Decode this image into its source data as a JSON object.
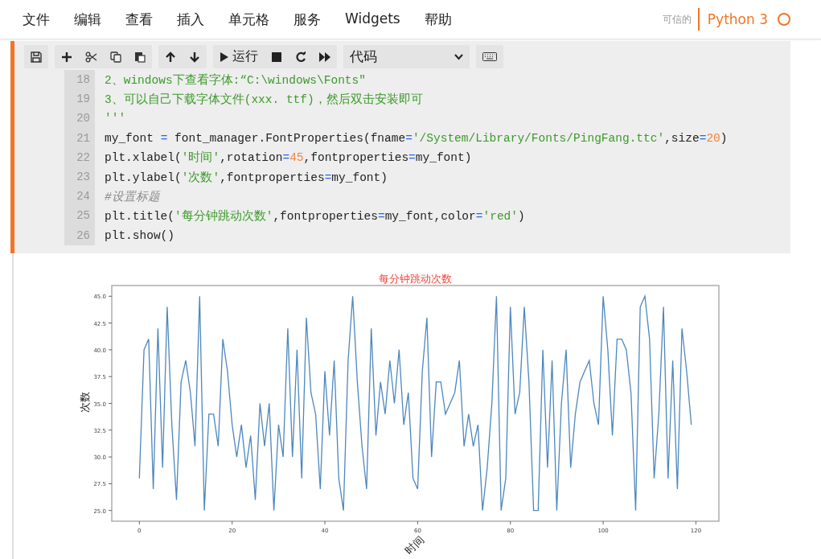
{
  "menu": [
    {
      "label": "文件"
    },
    {
      "label": "编辑"
    },
    {
      "label": "查看"
    },
    {
      "label": "插入"
    },
    {
      "label": "单元格"
    },
    {
      "label": "服务"
    },
    {
      "label": "Widgets"
    },
    {
      "label": "帮助"
    }
  ],
  "kernel": {
    "trusted_label": "可信的",
    "name": "Python 3",
    "busy": false
  },
  "toolbar": {
    "run_label": "运行",
    "cell_type": "代码"
  },
  "code_lines": [
    {
      "number": "18",
      "tokens": [
        {
          "kind": "str",
          "text": "2、windows下查看字体:“C:\\windows\\Fonts\""
        }
      ]
    },
    {
      "number": "19",
      "tokens": [
        {
          "kind": "str",
          "text": "3、可以自己下载字体文件(xxx. ttf)，然后双击安装即可"
        }
      ]
    },
    {
      "number": "20",
      "tokens": [
        {
          "kind": "str",
          "text": "'''"
        }
      ]
    },
    {
      "number": "21",
      "tokens": [
        {
          "kind": "plain",
          "text": "my_font "
        },
        {
          "kind": "op",
          "text": "="
        },
        {
          "kind": "plain",
          "text": " font_manager.FontProperties(fname"
        },
        {
          "kind": "op",
          "text": "="
        },
        {
          "kind": "str",
          "text": "'/System/Library/Fonts/PingFang.ttc'"
        },
        {
          "kind": "plain",
          "text": ",size"
        },
        {
          "kind": "op",
          "text": "="
        },
        {
          "kind": "num",
          "text": "20"
        },
        {
          "kind": "plain",
          "text": ")"
        }
      ]
    },
    {
      "number": "22",
      "tokens": [
        {
          "kind": "plain",
          "text": "plt.xlabel("
        },
        {
          "kind": "str",
          "text": "'时间'"
        },
        {
          "kind": "plain",
          "text": ",rotation"
        },
        {
          "kind": "op",
          "text": "="
        },
        {
          "kind": "num",
          "text": "45"
        },
        {
          "kind": "plain",
          "text": ",fontproperties"
        },
        {
          "kind": "op",
          "text": "="
        },
        {
          "kind": "plain",
          "text": "my_font)"
        }
      ]
    },
    {
      "number": "23",
      "tokens": [
        {
          "kind": "plain",
          "text": "plt.ylabel("
        },
        {
          "kind": "str",
          "text": "'次数'"
        },
        {
          "kind": "plain",
          "text": ",fontproperties"
        },
        {
          "kind": "op",
          "text": "="
        },
        {
          "kind": "plain",
          "text": "my_font)"
        }
      ]
    },
    {
      "number": "24",
      "tokens": [
        {
          "kind": "comment",
          "text": "#设置标题"
        }
      ]
    },
    {
      "number": "25",
      "tokens": [
        {
          "kind": "plain",
          "text": "plt.title("
        },
        {
          "kind": "str",
          "text": "'每分钟跳动次数'"
        },
        {
          "kind": "plain",
          "text": ",fontproperties"
        },
        {
          "kind": "op",
          "text": "="
        },
        {
          "kind": "plain",
          "text": "my_font,color"
        },
        {
          "kind": "op",
          "text": "="
        },
        {
          "kind": "str",
          "text": "'red'"
        },
        {
          "kind": "plain",
          "text": ")"
        }
      ]
    },
    {
      "number": "26",
      "tokens": [
        {
          "kind": "plain",
          "text": "plt.show()"
        }
      ]
    }
  ],
  "output": {
    "chart_data": {
      "type": "line",
      "title": "每分钟跳动次数",
      "xlabel": "时间",
      "ylabel": "次数",
      "xlim": [
        -5.95,
        124.95
      ],
      "ylim": [
        24,
        46
      ],
      "xticks": [
        0,
        20,
        40,
        60,
        80,
        100,
        120
      ],
      "x": [
        0,
        1,
        2,
        3,
        4,
        5,
        6,
        7,
        8,
        9,
        10,
        11,
        12,
        13,
        14,
        15,
        16,
        17,
        18,
        19,
        20,
        21,
        22,
        23,
        24,
        25,
        26,
        27,
        28,
        29,
        30,
        31,
        32,
        33,
        34,
        35,
        36,
        37,
        38,
        39,
        40,
        41,
        42,
        43,
        44,
        45,
        46,
        47,
        48,
        49,
        50,
        51,
        52,
        53,
        54,
        55,
        56,
        57,
        58,
        59,
        60,
        61,
        62,
        63,
        64,
        65,
        66,
        67,
        68,
        69,
        70,
        71,
        72,
        73,
        74,
        75,
        76,
        77,
        78,
        79,
        80,
        81,
        82,
        83,
        84,
        85,
        86,
        87,
        88,
        89,
        90,
        91,
        92,
        93,
        94,
        95,
        96,
        97,
        98,
        99,
        100,
        101,
        102,
        103,
        104,
        105,
        106,
        107,
        108,
        109,
        110,
        111,
        112,
        113,
        114,
        115,
        116,
        117,
        118,
        119
      ],
      "yticks": [
        {
          "value": 25,
          "label": "25.0"
        },
        {
          "value": 27.5,
          "label": "27.5"
        },
        {
          "value": 30,
          "label": "30.0"
        },
        {
          "value": 32.5,
          "label": "32.5"
        },
        {
          "value": 35,
          "label": "35.0"
        },
        {
          "value": 37.5,
          "label": "37.5"
        },
        {
          "value": 40,
          "label": "40.0"
        },
        {
          "value": 42.5,
          "label": "42.5"
        },
        {
          "value": 45,
          "label": "45.0"
        }
      ],
      "series": [
        {
          "color": "#4c87bd",
          "values": [
            28,
            40,
            41,
            27,
            42,
            29,
            44,
            33,
            26,
            37,
            39,
            36,
            31,
            45,
            25,
            34,
            34,
            31,
            41,
            38,
            33,
            30,
            33,
            29,
            32,
            26,
            35,
            31,
            35,
            25,
            33,
            30,
            42,
            30,
            40,
            28,
            43,
            36,
            34,
            27,
            38,
            32,
            39,
            28,
            25,
            39,
            45,
            37,
            31,
            27,
            42,
            32,
            37,
            34,
            39,
            35,
            40,
            33,
            36,
            28,
            27,
            38,
            43,
            30,
            37,
            37,
            34,
            35,
            36,
            39,
            31,
            34,
            31,
            33,
            25,
            29,
            35,
            45,
            25,
            28,
            44,
            34,
            36,
            44,
            37,
            25,
            25,
            40,
            29,
            39,
            25,
            35,
            40,
            29,
            34,
            37,
            38,
            39,
            35,
            33,
            45,
            40,
            32,
            41,
            41,
            40,
            36,
            25,
            44,
            45,
            41,
            28,
            34,
            44,
            28,
            39,
            27,
            42,
            38,
            33
          ]
        }
      ]
    }
  }
}
